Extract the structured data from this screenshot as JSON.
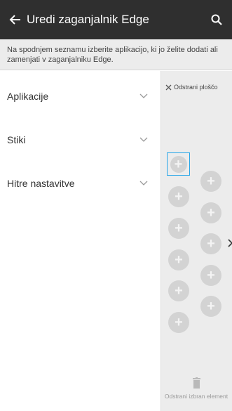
{
  "header": {
    "title": "Uredi zaganjalnik Edge",
    "back_icon": "back-arrow-icon",
    "search_icon": "search-icon",
    "background": "#2f2f2f"
  },
  "instruction": "Na spodnjem seznamu izberite aplikacijo, ki jo želite dodati ali zamenjati v zaganjalniku Edge.",
  "categories": [
    {
      "label": "Aplikacije"
    },
    {
      "label": "Stiki"
    },
    {
      "label": "Hitre nastavitve"
    }
  ],
  "panel": {
    "remove_tile_label": "Odstrani ploščo",
    "remove_selected_label": "Odstrani izbran element",
    "accent": "#27a6e8",
    "slot_symbol": "+"
  }
}
